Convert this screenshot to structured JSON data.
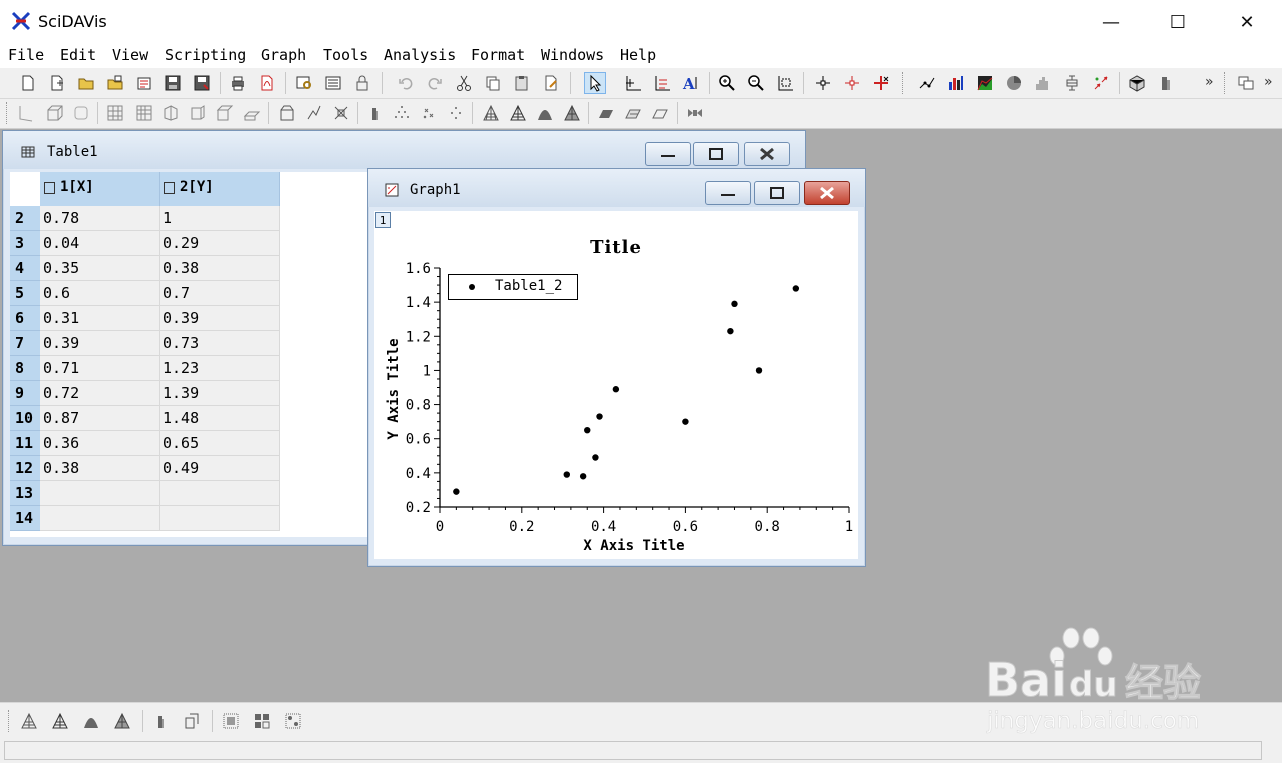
{
  "app": {
    "title": "SciDAVis"
  },
  "window_controls": {
    "minimize": "—",
    "maximize": "☐",
    "close": "✕"
  },
  "menu": [
    "File",
    "Edit",
    "View",
    "Scripting",
    "Graph",
    "Tools",
    "Analysis",
    "Format",
    "Windows",
    "Help"
  ],
  "toolbar": {
    "overflow_glyph": "»"
  },
  "table_window": {
    "title": "Table1",
    "columns": [
      "1[X]",
      "2[Y]"
    ],
    "rows": [
      {
        "n": "2",
        "x": "0.78",
        "y": "1"
      },
      {
        "n": "3",
        "x": "0.04",
        "y": "0.29"
      },
      {
        "n": "4",
        "x": "0.35",
        "y": "0.38"
      },
      {
        "n": "5",
        "x": "0.6",
        "y": "0.7"
      },
      {
        "n": "6",
        "x": "0.31",
        "y": "0.39"
      },
      {
        "n": "7",
        "x": "0.39",
        "y": "0.73"
      },
      {
        "n": "8",
        "x": "0.71",
        "y": "1.23"
      },
      {
        "n": "9",
        "x": "0.72",
        "y": "1.39"
      },
      {
        "n": "10",
        "x": "0.87",
        "y": "1.48"
      },
      {
        "n": "11",
        "x": "0.36",
        "y": "0.65"
      },
      {
        "n": "12",
        "x": "0.38",
        "y": "0.49"
      },
      {
        "n": "13",
        "x": "",
        "y": ""
      },
      {
        "n": "14",
        "x": "",
        "y": ""
      }
    ]
  },
  "graph_window": {
    "title": "Graph1",
    "layer_label": "1"
  },
  "chart_data": {
    "type": "scatter",
    "title": "Title",
    "xlabel": "X Axis Title",
    "ylabel": "Y Axis Title",
    "xlim": [
      0,
      1
    ],
    "ylim": [
      0.2,
      1.6
    ],
    "xticks": [
      "0",
      "0.2",
      "0.4",
      "0.6",
      "0.8",
      "1"
    ],
    "yticks": [
      "0.2",
      "0.4",
      "0.6",
      "0.8",
      "1",
      "1.2",
      "1.4",
      "1.6"
    ],
    "legend": "top-left",
    "series": [
      {
        "name": "Table1_2",
        "x": [
          0.78,
          0.04,
          0.35,
          0.6,
          0.31,
          0.39,
          0.71,
          0.72,
          0.87,
          0.36,
          0.38,
          0.43
        ],
        "y": [
          1,
          0.29,
          0.38,
          0.7,
          0.39,
          0.73,
          1.23,
          1.39,
          1.48,
          0.65,
          0.49,
          0.89
        ]
      }
    ]
  },
  "watermark": {
    "brand": "Bai",
    "brand2": "du",
    "cn": "经验",
    "url": "jingyan.baidu.com"
  }
}
